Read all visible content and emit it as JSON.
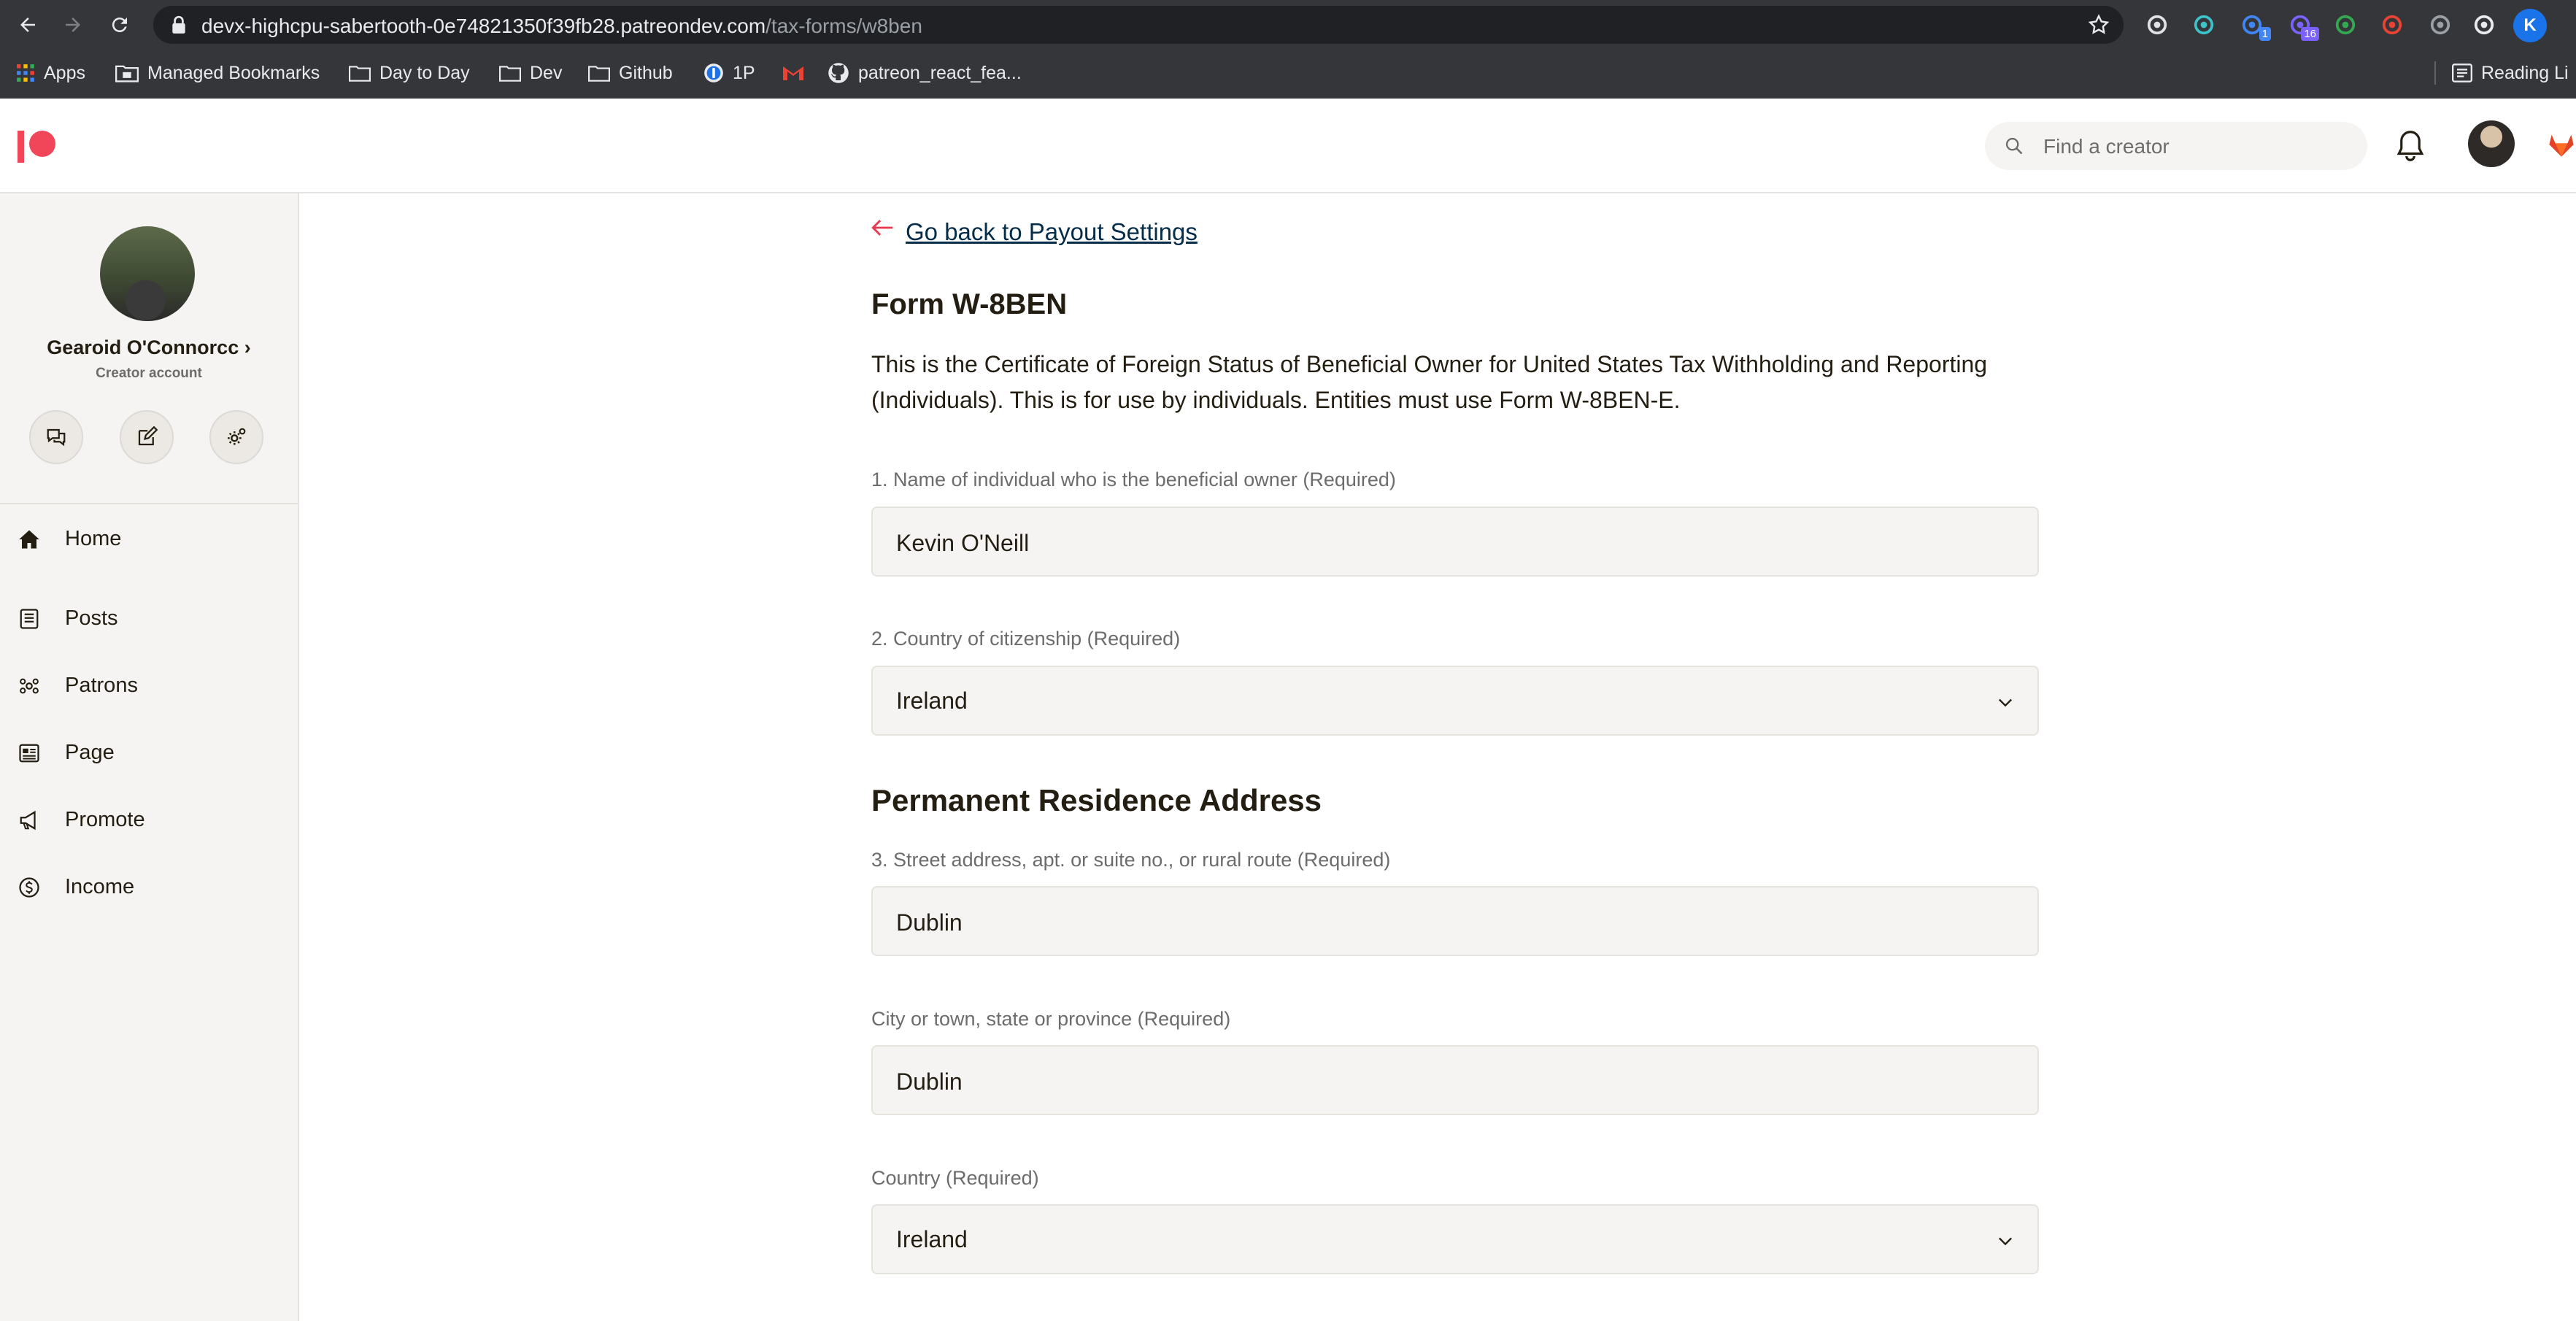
{
  "browser": {
    "url_host": "devx-highcpu-sabertooth-0e74821350f39fb28.patreondev.com",
    "url_path": "/tax-forms/w8ben",
    "extensions": [
      {
        "icon": "refresh-extension-icon",
        "color": "#dfe1e5"
      },
      {
        "icon": "cube-extension-icon",
        "color": "#3cc3c9"
      },
      {
        "icon": "blue-extension-icon",
        "color": "#4285f4",
        "badge": "1"
      },
      {
        "icon": "purple-extension-icon",
        "color": "#7b61ff",
        "badge": "16"
      },
      {
        "icon": "green-ring-extension-icon",
        "color": "#34a853"
      },
      {
        "icon": "red-extension-icon",
        "color": "#ea4335"
      },
      {
        "icon": "bracket-extension-icon",
        "color": "#9aa0a6"
      },
      {
        "icon": "puzzle-icon",
        "color": "#e8eaed"
      }
    ],
    "profile_initial": "K",
    "bookmarks": [
      {
        "label": "Apps",
        "icon": "apps-grid-icon"
      },
      {
        "label": "Managed Bookmarks",
        "icon": "folder-icon"
      },
      {
        "label": "Day to Day",
        "icon": "folder-icon"
      },
      {
        "label": "Dev",
        "icon": "folder-icon"
      },
      {
        "label": "Github",
        "icon": "folder-icon"
      },
      {
        "label": "1P",
        "icon": "onepassword-icon"
      },
      {
        "label": "",
        "icon": "gmail-icon"
      },
      {
        "label": "patreon_react_fea...",
        "icon": "github-icon"
      }
    ],
    "reading_list": "Reading Li"
  },
  "header": {
    "search_placeholder": "Find a creator"
  },
  "sidebar": {
    "user_name": "Gearoid O'Connorcc",
    "user_chevron": "›",
    "account_type": "Creator account",
    "actions": [
      "messages-icon",
      "edit-icon",
      "settings-icon"
    ],
    "nav": [
      {
        "label": "Home",
        "icon": "home-icon"
      },
      {
        "label": "Posts",
        "icon": "posts-icon"
      },
      {
        "label": "Patrons",
        "icon": "patrons-icon"
      },
      {
        "label": "Page",
        "icon": "page-icon"
      },
      {
        "label": "Promote",
        "icon": "megaphone-icon"
      },
      {
        "label": "Income",
        "icon": "dollar-icon"
      }
    ]
  },
  "form": {
    "back_link": "Go back to Payout Settings",
    "title": "Form W-8BEN",
    "description": "This is the Certificate of Foreign Status of Beneficial Owner for United States Tax Withholding and Reporting (Individuals). This is for use by individuals. Entities must use Form W-8BEN-E.",
    "name_label": "1. Name of individual who is the beneficial owner (Required)",
    "name_value": "Kevin O'Neill",
    "citizenship_label": "2. Country of citizenship (Required)",
    "citizenship_value": "Ireland",
    "residence_heading": "Permanent Residence Address",
    "street_label": "3. Street address, apt. or suite no., or rural route (Required)",
    "street_value": "Dublin",
    "city_label": "City or town, state or province (Required)",
    "city_value": "Dublin",
    "country_label": "Country (Required)",
    "country_value": "Ireland"
  }
}
